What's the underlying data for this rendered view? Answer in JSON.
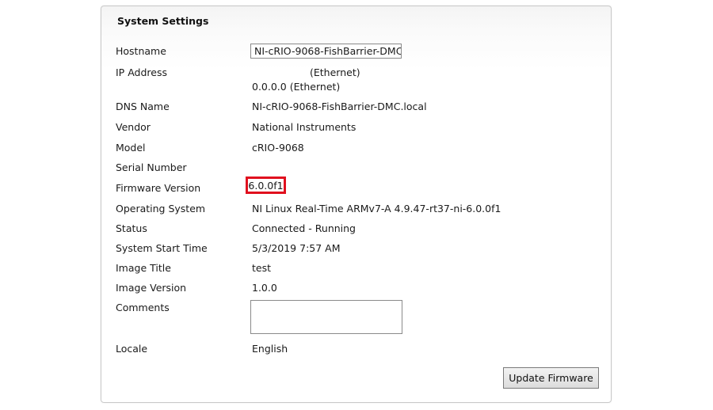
{
  "panel": {
    "title": "System Settings"
  },
  "fields": {
    "hostname": {
      "label": "Hostname",
      "value": "NI-cRIO-9068-FishBarrier-DMC"
    },
    "ip_address": {
      "label": "IP Address",
      "adapter": "(Ethernet)",
      "value": "0.0.0.0 (Ethernet)"
    },
    "dns_name": {
      "label": "DNS Name",
      "value": "NI-cRIO-9068-FishBarrier-DMC.local"
    },
    "vendor": {
      "label": "Vendor",
      "value": "National Instruments"
    },
    "model": {
      "label": "Model",
      "value": "cRIO-9068"
    },
    "serial_number": {
      "label": "Serial Number",
      "value": ""
    },
    "firmware_version": {
      "label": "Firmware Version",
      "value": "6.0.0f1"
    },
    "operating_system": {
      "label": "Operating System",
      "value": "NI Linux Real-Time ARMv7-A 4.9.47-rt37-ni-6.0.0f1"
    },
    "status": {
      "label": "Status",
      "value": "Connected - Running"
    },
    "system_start_time": {
      "label": "System Start Time",
      "value": "5/3/2019 7:57 AM"
    },
    "image_title": {
      "label": "Image Title",
      "value": "test"
    },
    "image_version": {
      "label": "Image Version",
      "value": "1.0.0"
    },
    "comments": {
      "label": "Comments",
      "value": ""
    },
    "locale": {
      "label": "Locale",
      "value": "English"
    }
  },
  "buttons": {
    "update_firmware": "Update Firmware"
  },
  "colors": {
    "highlight": "#e0101e"
  }
}
